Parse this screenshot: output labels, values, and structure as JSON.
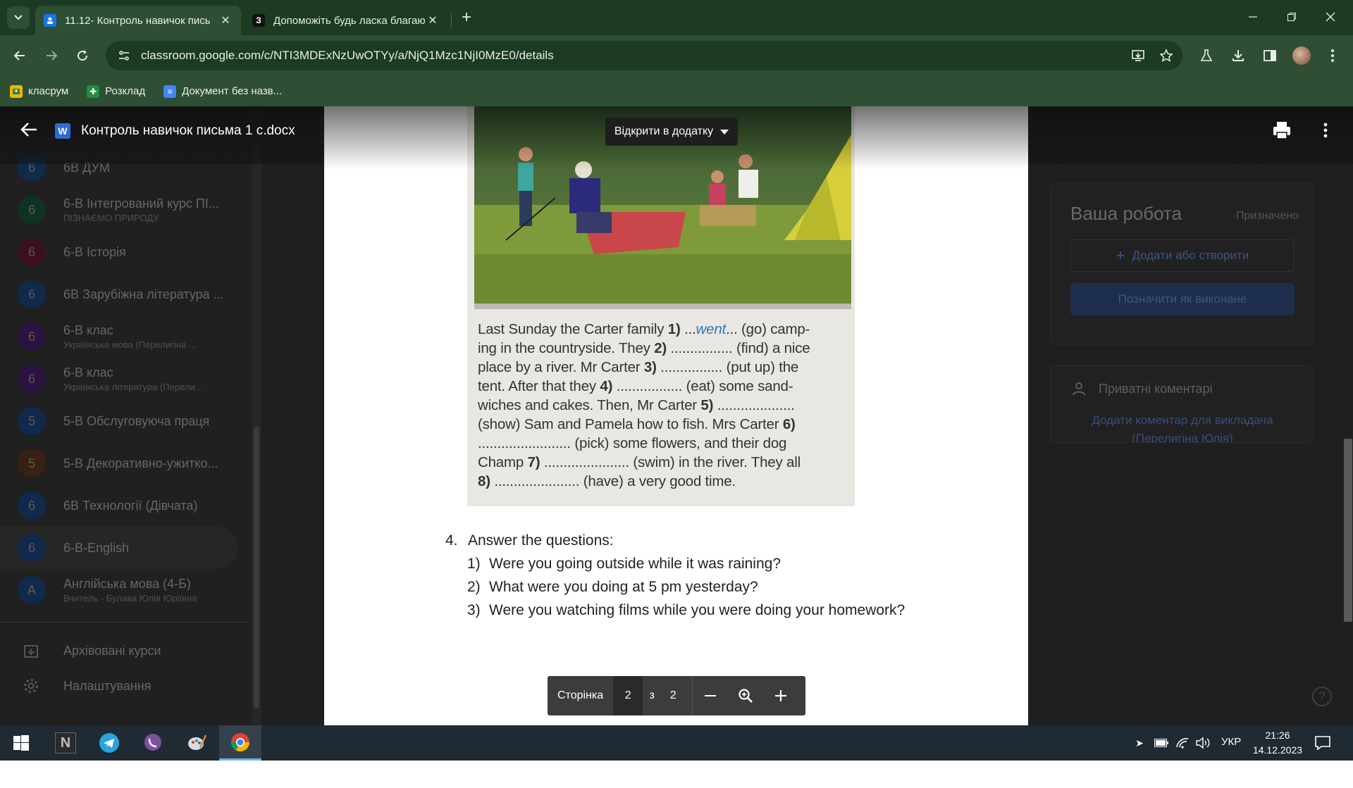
{
  "browser": {
    "tabs": [
      {
        "title": "11.12- Контроль навичок пись",
        "active": true
      },
      {
        "title": "Допоможіть будь ласка благаю",
        "active": false,
        "favicon_letter": "З"
      }
    ],
    "url": "classroom.google.com/c/NTI3MDExNzUwOTYy/a/NjQ1Mzc1NjI0MzE0/details",
    "bookmarks": [
      {
        "label": "класрум",
        "icon": "classroom-icon"
      },
      {
        "label": "Розклад",
        "icon": "sheets-icon"
      },
      {
        "label": "Документ без назв...",
        "icon": "docs-icon"
      }
    ]
  },
  "viewer": {
    "file_title": "Контроль навичок письма 1 с.docx",
    "word_badge": "W",
    "open_in_label": "Відкрити в додатку",
    "pager": {
      "label": "Сторінка",
      "current": "2",
      "of": "з",
      "total": "2"
    }
  },
  "document": {
    "exercise_lines": [
      [
        "Last Sunday the Carter family ",
        "1)",
        " ...",
        "went",
        "... (go) camp-"
      ],
      [
        "ing in the countryside. They ",
        "2)",
        " ................ (find) a nice",
        "",
        ""
      ],
      [
        "place by a river. Mr Carter ",
        "3)",
        " ................ (put up) the",
        "",
        ""
      ],
      [
        "tent. After that they ",
        "4)",
        " ................. (eat) some sand-",
        "",
        ""
      ],
      [
        "wiches and cakes. Then, Mr Carter ",
        "5)",
        " ....................",
        "",
        ""
      ],
      [
        "(show) Sam and Pamela how to fish. Mrs Carter ",
        "6)",
        "",
        "",
        ""
      ],
      [
        "........................ (pick) some flowers, and their dog",
        "",
        "",
        "",
        ""
      ],
      [
        "Champ ",
        "7)",
        " ...................... (swim) in the river. They all",
        "",
        ""
      ],
      [
        "8)",
        "",
        " ...................... (have) a very good time.",
        "",
        ""
      ]
    ],
    "section_number": "4.",
    "section_title": "Answer the questions:",
    "questions": [
      {
        "n": "1)",
        "text": "Were you going outside while it was raining?"
      },
      {
        "n": "2)",
        "text": "What were you doing at 5 pm yesterday?"
      },
      {
        "n": "3)",
        "text": "Were you watching films while you were doing your homework?"
      }
    ]
  },
  "sidebar": {
    "courses": [
      {
        "avatar": "6",
        "title": "6В ДУМ",
        "subtitle": "",
        "color": "#0f2a4a"
      },
      {
        "avatar": "6",
        "title": "6-В Інтегрований курс ПІ...",
        "subtitle": "ПІЗНАЄМО ПРИРОДУ",
        "color": "#0f3322"
      },
      {
        "avatar": "6",
        "title": "6-В Історія",
        "subtitle": "",
        "color": "#3a1020"
      },
      {
        "avatar": "6",
        "title": "6В Зарубіжна література ...",
        "subtitle": "",
        "color": "#0f2a4a"
      },
      {
        "avatar": "6",
        "title": "6-В клас",
        "subtitle": "Українська мова (Перелигіна ...",
        "color": "#2b1240"
      },
      {
        "avatar": "6",
        "title": "6-В клас",
        "subtitle": "Українська література (Перели...",
        "color": "#2b1240"
      },
      {
        "avatar": "5",
        "title": "5-В Обслуговуюча праця",
        "subtitle": "",
        "color": "#0f2a4a"
      },
      {
        "avatar": "5",
        "title": "5-В Декоративно-ужитко...",
        "subtitle": "",
        "color": "#3a2010"
      },
      {
        "avatar": "6",
        "title": "6В Технології (Дівчата)",
        "subtitle": "",
        "color": "#0f2a4a"
      },
      {
        "avatar": "6",
        "title": "6-В-English",
        "subtitle": "",
        "color": "#0f2a4a"
      },
      {
        "avatar": "A",
        "title": "Англійська мова (4-Б)",
        "subtitle": "Вчитель - Булава Юлія Юріївна",
        "color": "#0f2a4a"
      }
    ],
    "archived_label": "Архівовані курси",
    "settings_label": "Налаштування"
  },
  "work_panel": {
    "title": "Ваша робота",
    "status": "Призначено",
    "add_label": "Додати або створити",
    "mark_done_label": "Позначити як виконане"
  },
  "private_comments": {
    "title": "Приватні коментарі",
    "add_link": "Додати коментар для викладача",
    "teacher_partial": "(Перелигіна Юлія)"
  },
  "taskbar": {
    "lang": "УКР",
    "time": "21:26",
    "date": "14.12.2023"
  },
  "colors": {
    "chrome_dark": "#1d3a22",
    "chrome": "#2e4f33",
    "taskbar": "#1f2a33",
    "handwriting": "#2f7ab5"
  }
}
